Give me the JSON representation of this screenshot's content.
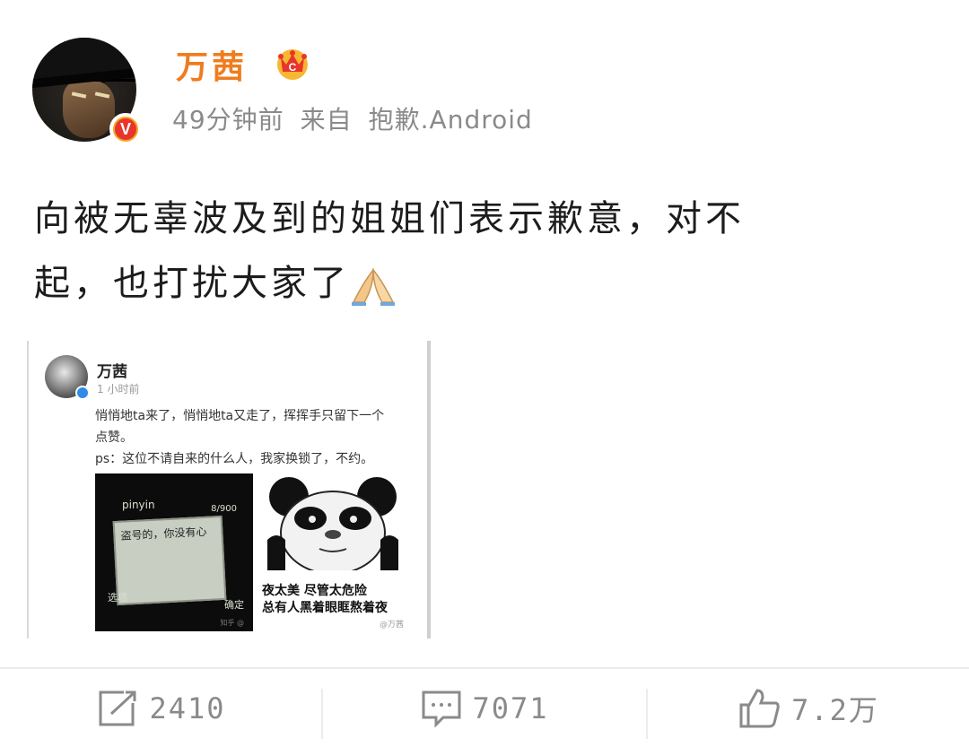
{
  "author": {
    "name": "万茜",
    "verified_badge": "V",
    "crown_icon": "crown-icon"
  },
  "meta": {
    "time": "49分钟前",
    "from_label": "来自",
    "source": "抱歉.Android"
  },
  "post": {
    "text_line1": "向被无辜波及到的姐姐们表示歉意，对不",
    "text_line2": "起，也打扰大家了",
    "emoji": "praying-hands"
  },
  "attached_image": {
    "name": "万茜",
    "time": "1 小时前",
    "line1": "悄悄地ta来了，悄悄地ta又走了，挥挥手只留下一个",
    "line2": "点赞。",
    "line3": "ps：这位不请自来的什么人，我家换锁了，不约。",
    "phone_ime": "pinyin",
    "phone_count": "8/900",
    "phone_text": "盗号的，你没有心",
    "phone_left_softkey": "选项",
    "phone_right_softkey": "确定",
    "phone_watermark": "知乎 @",
    "panda_caption_1": "夜太美 尽管太危险",
    "panda_caption_2": "总有人黑着眼眶熬着夜",
    "watermark": "@万茜"
  },
  "actions": {
    "repost_count": "2410",
    "comment_count": "7071",
    "like_count": "7.2万"
  },
  "colors": {
    "username": "#f07c1d",
    "meta_gray": "#8a8a8a",
    "badge_orange": "#f5a623",
    "badge_red": "#e8352b",
    "verify_blue": "#2f8ce6"
  }
}
